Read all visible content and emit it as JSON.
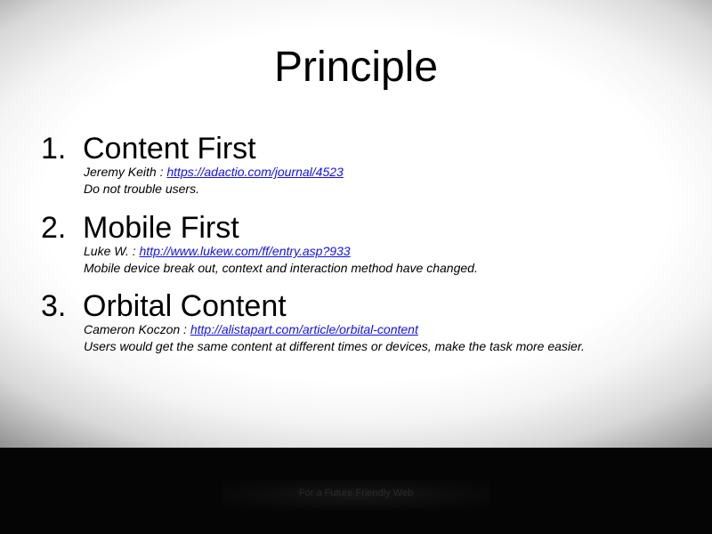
{
  "slide": {
    "title": "Principle",
    "items": [
      {
        "number": "1.",
        "title": "Content First",
        "ref_author": "Jeremy Keith : ",
        "ref_url": "https://adactio.com/journal/4523",
        "description": "Do not trouble users."
      },
      {
        "number": "2.",
        "title": "Mobile First",
        "ref_author": "Luke W. : ",
        "ref_url": "http://www.lukew.com/ff/entry.asp?933",
        "description": "Mobile device break out, context and interaction method have changed."
      },
      {
        "number": "3.",
        "title": "Orbital Content",
        "ref_author": "Cameron Koczon : ",
        "ref_url": "http://alistapart.com/article/orbital-content",
        "description": "Users would get the same content at different times or devices, make the task more easier."
      }
    ]
  },
  "footer": {
    "text": "For a Future Friendly Web"
  },
  "colors": {
    "link": "#1111ee",
    "footer_background": "#050505",
    "footer_text": "#2a2a2a"
  }
}
